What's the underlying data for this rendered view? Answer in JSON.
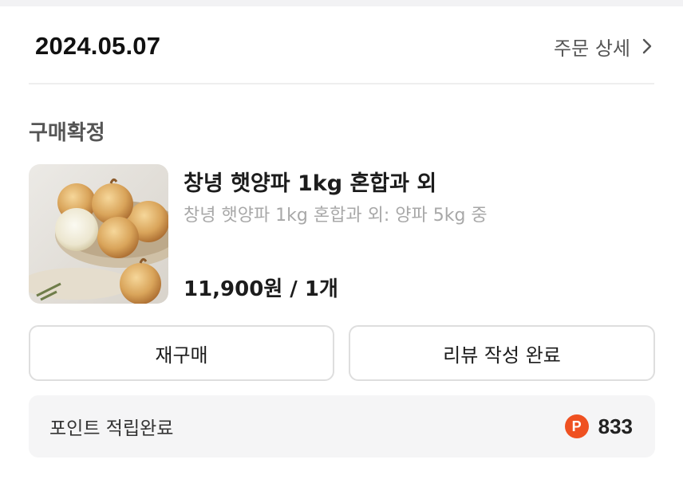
{
  "order": {
    "date": "2024.05.07",
    "detail_link": "주문 상세"
  },
  "status": "구매확정",
  "product": {
    "image": "onion-product-image",
    "title": "창녕 햇양파 1kg 혼합과 외",
    "option": "창녕 햇양파 1kg 혼합과 외: 양파 5kg 중",
    "price": "11,900원 / 1개"
  },
  "actions": {
    "rebuy": "재구매",
    "review": "리뷰 작성 완료"
  },
  "points": {
    "label": "포인트 적립완료",
    "badge": "P",
    "value": "833",
    "badge_color": "#ef5121"
  }
}
